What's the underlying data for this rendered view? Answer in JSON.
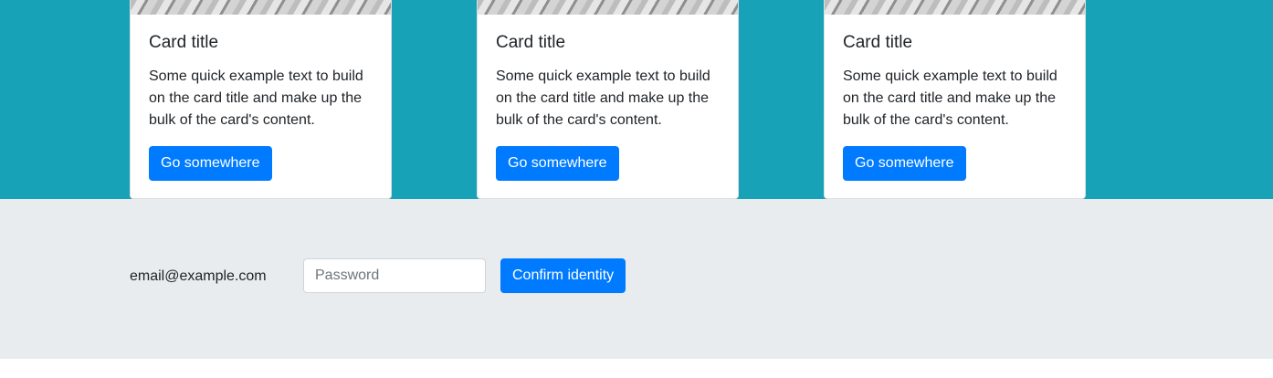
{
  "cards": [
    {
      "title": "Card title",
      "text": "Some quick example text to build on the card title and make up the bulk of the card's content.",
      "button_label": "Go somewhere"
    },
    {
      "title": "Card title",
      "text": "Some quick example text to build on the card title and make up the bulk of the card's content.",
      "button_label": "Go somewhere"
    },
    {
      "title": "Card title",
      "text": "Some quick example text to build on the card title and make up the bulk of the card's content.",
      "button_label": "Go somewhere"
    }
  ],
  "identity_form": {
    "email": "email@example.com",
    "password_placeholder": "Password",
    "confirm_label": "Confirm identity"
  },
  "colors": {
    "band_background": "#17a2b8",
    "form_background": "#e9ecef",
    "primary": "#007bff"
  }
}
